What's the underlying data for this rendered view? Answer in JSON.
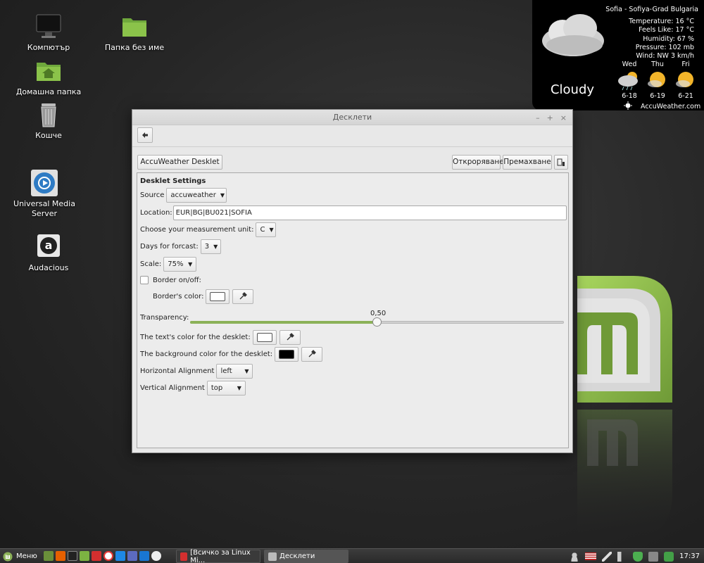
{
  "desktop": {
    "icons": [
      {
        "label": "Компютър",
        "icon": "computer-icon"
      },
      {
        "label": "Папка без име",
        "icon": "folder-icon"
      },
      {
        "label": "Домашна папка",
        "icon": "home-folder-icon"
      },
      {
        "label": "Кошче",
        "icon": "trash-icon"
      },
      {
        "label": "Universal Media Server",
        "icon": "media-server-icon"
      },
      {
        "label": "Audacious",
        "icon": "audacious-icon"
      }
    ]
  },
  "weather": {
    "location": "Sofia - Sofiya-Grad Bulgaria",
    "temperature": "Temperature: 16 °C",
    "feels_like": "Feels Like: 17 °C",
    "humidity": "Humidity: 67 %",
    "pressure": "Pressure: 102 mb",
    "wind": "Wind: NW 3 km/h",
    "condition": "Cloudy",
    "forecast": [
      {
        "day": "Wed",
        "range": "6-18"
      },
      {
        "day": "Thu",
        "range": "6-19"
      },
      {
        "day": "Fri",
        "range": "6-21"
      }
    ],
    "provider": "AccuWeather.com"
  },
  "window": {
    "title": "Десклети",
    "buttons": {
      "minimize": "–",
      "maximize": "+",
      "close": "×"
    },
    "desklet_name": "AccuWeather Desklet",
    "open_label": "Откроряване",
    "remove_label": "Премахване",
    "settings": {
      "heading": "Desklet Settings",
      "source_label": "Source",
      "source_value": "accuweather",
      "location_label": "Location:",
      "location_value": "EUR|BG|BU021|SOFIA",
      "unit_label": "Choose your measurement unit:",
      "unit_value": "C",
      "days_label": "Days for forcast:",
      "days_value": "3",
      "scale_label": "Scale:",
      "scale_value": "75%",
      "border_label": "Border on/off:",
      "border_checked": false,
      "border_color_label": "Border's color:",
      "border_color": "#ffffff",
      "transparency_label": "Transparency:",
      "transparency_value": "0,50",
      "transparency_fraction": 0.5,
      "text_color_label": "The text's color for the desklet:",
      "text_color": "#ffffff",
      "bg_color_label": "The background color for the desklet:",
      "bg_color": "#000000",
      "halign_label": "Horizontal Alignment",
      "halign_value": "left",
      "valign_label": "Vertical Alignment",
      "valign_value": "top"
    }
  },
  "taskbar": {
    "menu_label": "Меню",
    "tasks": [
      {
        "label": "[Всичко за Linux Mi...",
        "icon": "vivaldi-icon",
        "active": false
      },
      {
        "label": "Десклети",
        "icon": "desklets-icon",
        "active": true
      }
    ],
    "clock": "17:37"
  },
  "colors": {
    "mint_green": "#8bb158",
    "dark_bg": "#262626"
  }
}
